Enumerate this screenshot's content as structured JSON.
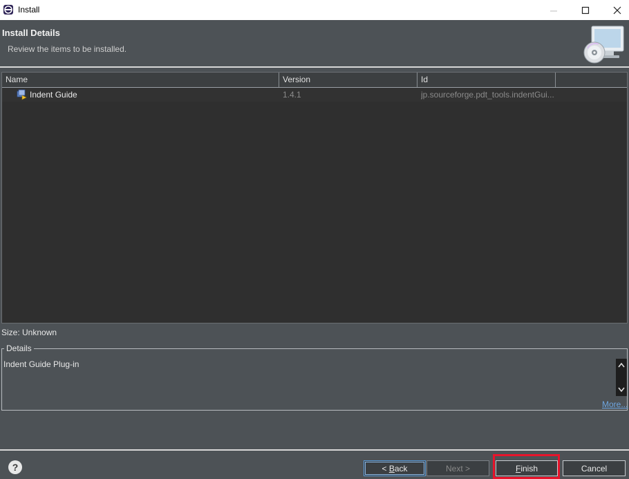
{
  "window": {
    "title": "Install",
    "icon": "eclipse-icon",
    "controls": [
      "minimize-icon",
      "maximize-icon",
      "close-icon"
    ]
  },
  "header": {
    "title": "Install Details",
    "description": "Review the items to be installed.",
    "image_icon": "install-monitor-cd-icon"
  },
  "table": {
    "columns": [
      "Name",
      "Version",
      "Id",
      ""
    ],
    "rows": [
      {
        "icon": "feature-plugin-icon",
        "name": "Indent Guide",
        "version": "1.4.1",
        "id": "jp.sourceforge.pdt_tools.indentGui..."
      }
    ]
  },
  "size": "Size: Unknown",
  "details": {
    "legend": "Details",
    "text": "Indent Guide Plug-in",
    "more_link": "More..."
  },
  "buttons": {
    "help": "?",
    "back_prefix": "< ",
    "back_mnemonic": "B",
    "back_rest": "ack",
    "next": "Next >",
    "finish_mnemonic": "F",
    "finish_rest": "inish",
    "cancel": "Cancel"
  },
  "colors": {
    "background": "#4d5256",
    "table_bg": "#2f2f2f",
    "highlight": "#e8142b",
    "link": "#6ea6e0"
  }
}
